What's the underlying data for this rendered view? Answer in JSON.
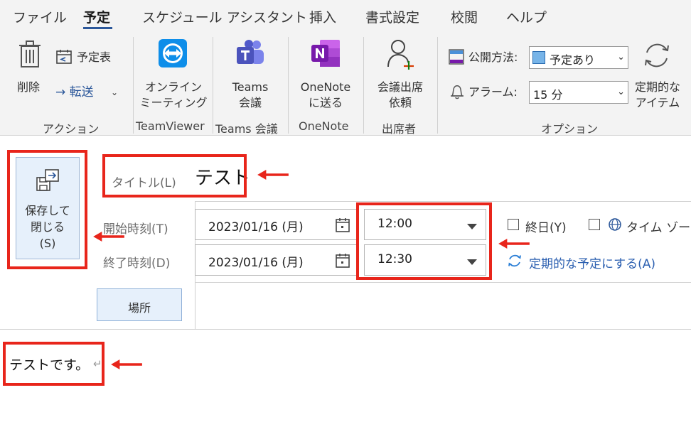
{
  "menu": {
    "tabs": [
      "ファイル",
      "予定",
      "スケジュール アシスタント",
      "挿入",
      "書式設定",
      "校閲",
      "ヘルプ"
    ]
  },
  "ribbon": {
    "action": {
      "delete": "削除",
      "calendar": "予定表",
      "forward": "→ 転送",
      "group": "アクション"
    },
    "teamviewer": {
      "label1": "オンライン",
      "label2": "ミーティング",
      "group": "TeamViewer"
    },
    "teams": {
      "label1": "Teams",
      "label2": "会議",
      "group": "Teams 会議"
    },
    "onenote": {
      "label1": "OneNote",
      "label2": "に送る",
      "group": "OneNote"
    },
    "attendees": {
      "label1": "会議出席",
      "label2": "依頼",
      "group": "出席者"
    },
    "options": {
      "show_as_label": "公開方法:",
      "show_as_value": "予定あり",
      "reminder_label": "アラーム:",
      "reminder_value": "15 分",
      "recurring1": "定期的な",
      "recurring2": "アイテム",
      "group": "オプション"
    }
  },
  "form": {
    "save_close1": "保存して",
    "save_close2": "閉じる",
    "save_close3": "(S)",
    "title_label": "タイトル(L)",
    "title_value": "テスト",
    "start_label": "開始時刻(T)",
    "end_label": "終了時刻(D)",
    "start_date": "2023/01/16 (月)",
    "end_date": "2023/01/16 (月)",
    "start_time": "12:00",
    "end_time": "12:30",
    "all_day": "終日(Y)",
    "time_zone": "タイム ゾーン",
    "make_recurring": "定期的な予定にする(A)",
    "location_button": "場所",
    "body_text": "テストです。",
    "return_mark": "↵"
  },
  "colors": {
    "annotation_red": "#e8251b",
    "accent_blue": "#2b579a"
  }
}
